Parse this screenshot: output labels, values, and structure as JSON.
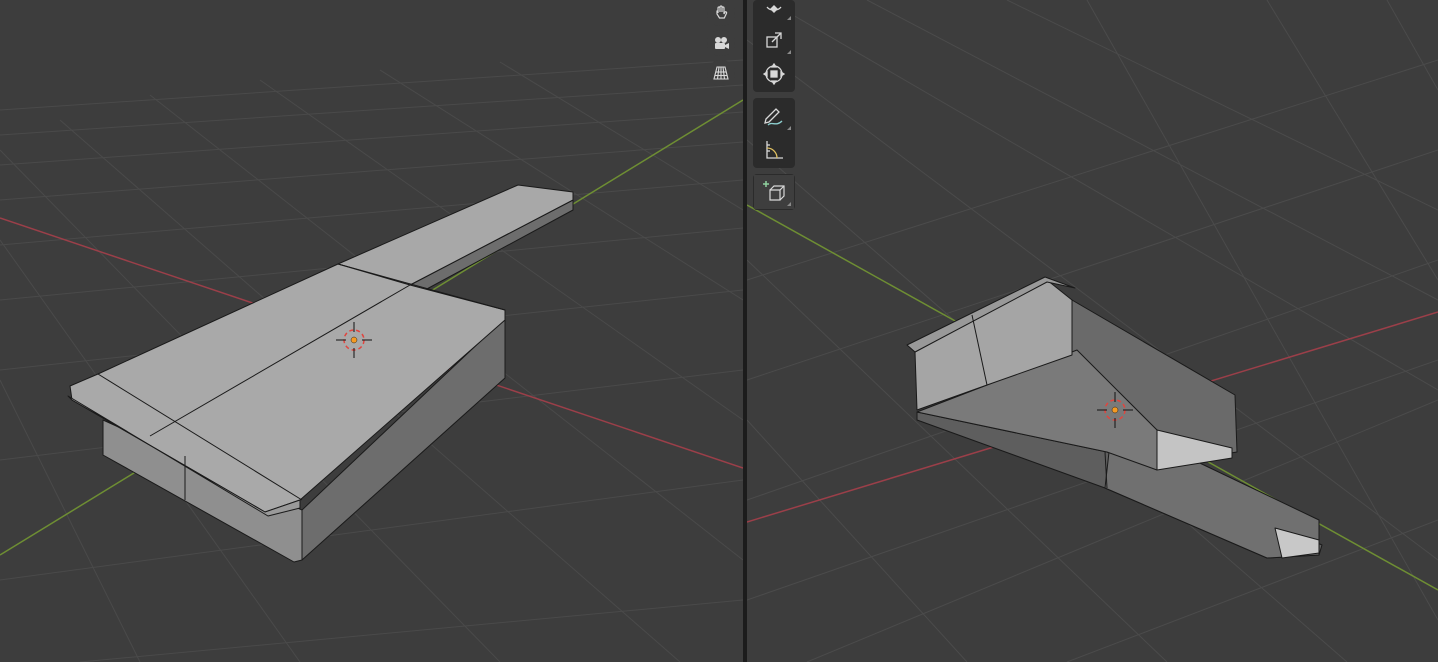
{
  "colors": {
    "viewport_bg": "#3d3d3d",
    "grid": "#4b4b4b",
    "x_axis": "#9b3f49",
    "y_axis": "#6e8e33",
    "mesh_light": "#a6a6a6",
    "mesh_mid": "#8d8d8d",
    "mesh_dark": "#6a6a6a",
    "edge": "#1a1a1a",
    "cursor_red": "#e0453f",
    "origin": "#f59a23"
  },
  "left_viewport": {
    "nav_gizmo": {
      "icons": [
        "pan-hand-icon",
        "camera-view-icon",
        "perspective-grid-icon"
      ]
    }
  },
  "right_viewport": {
    "toolbar": {
      "groups": [
        [
          "rotate-tool-icon",
          "scale-tool-icon",
          "transform-tool-icon"
        ],
        [
          "annotate-tool-icon",
          "measure-tool-icon"
        ],
        [
          "add-cube-tool-icon"
        ]
      ]
    }
  }
}
